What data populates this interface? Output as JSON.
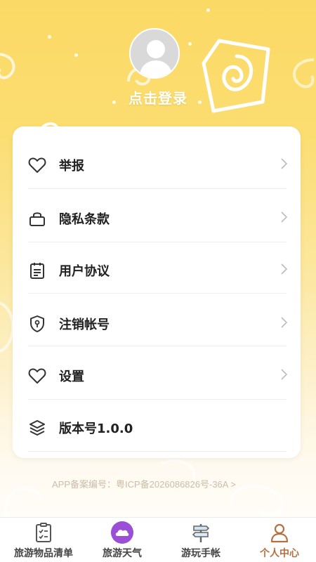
{
  "header": {
    "login_text": "点击登录"
  },
  "menu": {
    "items": [
      {
        "label": "举报",
        "icon": "heart-icon",
        "has_chevron": true
      },
      {
        "label": "隐私条款",
        "icon": "lock-icon",
        "has_chevron": true
      },
      {
        "label": "用户协议",
        "icon": "clipboard-icon",
        "has_chevron": true
      },
      {
        "label": "注销帐号",
        "icon": "shield-icon",
        "has_chevron": true
      },
      {
        "label": "设置",
        "icon": "heart-icon",
        "has_chevron": true
      },
      {
        "label": "版本号1.0.0",
        "icon": "layers-icon",
        "has_chevron": false
      }
    ]
  },
  "footer": {
    "icp": "APP备案编号：粤ICP备2026086826号-36A  >"
  },
  "tabbar": {
    "tabs": [
      {
        "label": "旅游物品清单",
        "icon": "checklist-icon",
        "active": false
      },
      {
        "label": "旅游天气",
        "icon": "cloud-icon",
        "active": false
      },
      {
        "label": "游玩手帐",
        "icon": "signpost-icon",
        "active": false
      },
      {
        "label": "个人中心",
        "icon": "person-icon",
        "active": true
      }
    ]
  },
  "colors": {
    "background_top": "#fbd965",
    "accent_active_tab": "#b5703f",
    "cloud_icon": "#9b4fd6",
    "text_primary": "#222222"
  }
}
